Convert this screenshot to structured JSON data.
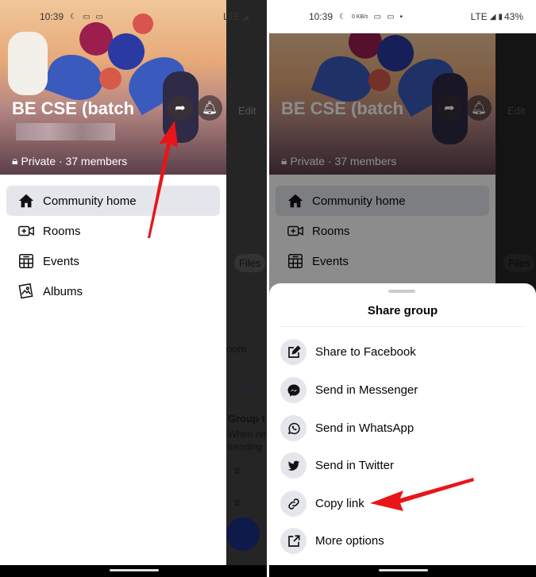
{
  "left": {
    "status": {
      "time": "10:39",
      "net": "LTE"
    },
    "group": {
      "name": "BE CSE (batch",
      "meta": "Private · 37 members"
    },
    "nav": [
      {
        "label": "Community home",
        "icon": "home-icon"
      },
      {
        "label": "Rooms",
        "icon": "video-plus-icon"
      },
      {
        "label": "Events",
        "icon": "calendar-icon"
      },
      {
        "label": "Albums",
        "icon": "photo-album-icon"
      }
    ],
    "behind": {
      "edit": "Edit",
      "files": "Files",
      "room": "oom",
      "add": "Add",
      "group": "Group t",
      "when": "When ne",
      "trending": "trending",
      "hash": "#"
    }
  },
  "right": {
    "status": {
      "time": "10:39",
      "speed": "0 KB/s",
      "net": "LTE",
      "battery": "43%"
    },
    "sheet": {
      "title": "Share group",
      "options": [
        {
          "label": "Share to Facebook",
          "icon": "compose-icon"
        },
        {
          "label": "Send in Messenger",
          "icon": "messenger-icon"
        },
        {
          "label": "Send in WhatsApp",
          "icon": "whatsapp-icon"
        },
        {
          "label": "Send in Twitter",
          "icon": "twitter-icon"
        },
        {
          "label": "Copy link",
          "icon": "link-icon"
        },
        {
          "label": "More options",
          "icon": "external-icon"
        }
      ]
    }
  },
  "colors": {
    "annotation_arrow": "#e8151b",
    "active_bg": "#e4e6eb"
  }
}
